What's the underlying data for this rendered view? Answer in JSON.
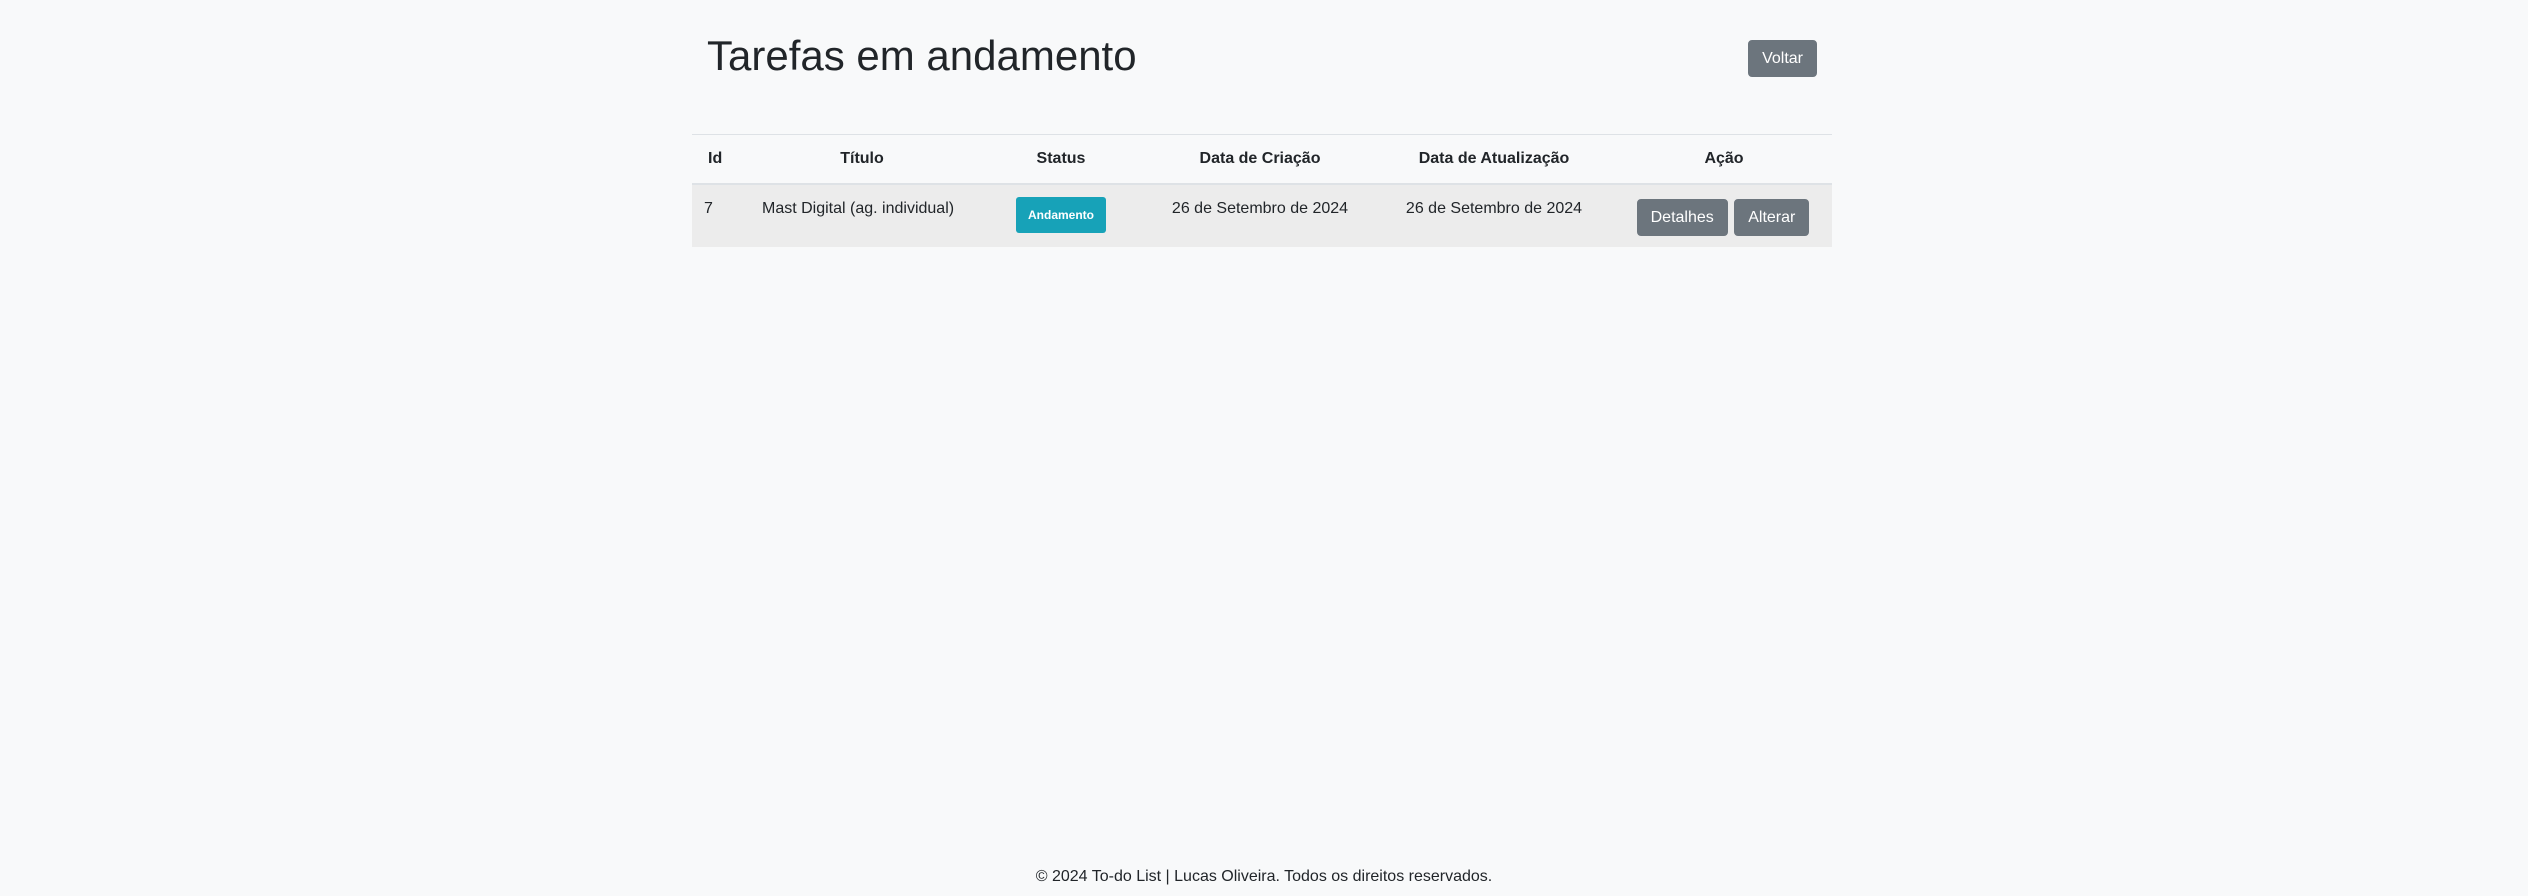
{
  "page": {
    "title": "Tarefas em andamento",
    "back_label": "Voltar"
  },
  "table": {
    "headers": {
      "id": "Id",
      "title": "Título",
      "status": "Status",
      "created": "Data de Criação",
      "updated": "Data de Atualização",
      "action": "Ação"
    },
    "rows": [
      {
        "id": "7",
        "title": "Mast Digital (ag. individual)",
        "status": "Andamento",
        "created": "26 de Setembro de 2024",
        "updated": "26 de Setembro de 2024",
        "details_label": "Detalhes",
        "edit_label": "Alterar"
      }
    ]
  },
  "footer": {
    "text": "© 2024 To-do List | Lucas Oliveira. Todos os direitos reservados."
  },
  "colors": {
    "background": "#f8f9fa",
    "secondary_button": "#6c757d",
    "status_badge": "#17a2b8",
    "row_background": "#ececec"
  }
}
